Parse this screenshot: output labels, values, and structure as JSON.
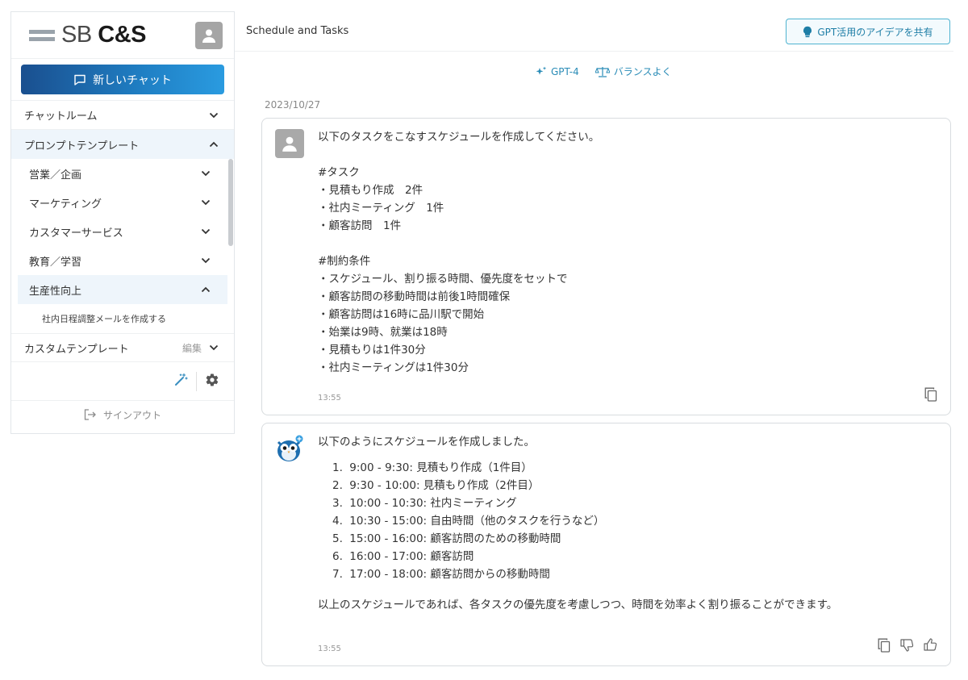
{
  "brand": {
    "logo_prefix": "SB ",
    "logo_main": "C&S"
  },
  "sidebar": {
    "new_chat_label": "新しいチャット",
    "chat_room_label": "チャットルーム",
    "prompt_template_label": "プロンプトテンプレート",
    "categories": [
      {
        "label": "営業／企画"
      },
      {
        "label": "マーケティング"
      },
      {
        "label": "カスタマーサービス"
      },
      {
        "label": "教育／学習"
      },
      {
        "label": "生産性向上"
      }
    ],
    "sub_item_label": "社内日程調整メールを作成する",
    "custom_template_label": "カスタムテンプレート",
    "edit_label": "編集",
    "signout_label": "サインアウト"
  },
  "header": {
    "title": "Schedule and Tasks",
    "share_label": "GPT活用のアイデアを共有"
  },
  "mode": {
    "model_label": "GPT-4",
    "style_label": "バランスよく"
  },
  "conversation": {
    "date": "2023/10/27",
    "user_message": {
      "lines": [
        "以下のタスクをこなすスケジュールを作成してください。",
        "",
        "#タスク",
        "・見積もり作成　2件",
        "・社内ミーティング　1件",
        "・顧客訪問　1件",
        "",
        "#制約条件",
        "・スケジュール、割り振る時間、優先度をセットで",
        "・顧客訪問の移動時間は前後1時間確保",
        "・顧客訪問は16時に品川駅で開始",
        "・始業は9時、就業は18時",
        "・見積もりは1件30分",
        "・社内ミーティングは1件30分"
      ],
      "time": "13:55"
    },
    "bot_message": {
      "intro": "以下のようにスケジュールを作成しました。",
      "items": [
        {
          "num": "1.",
          "text": "9:00 - 9:30: 見積もり作成（1件目）"
        },
        {
          "num": "2.",
          "text": "9:30 - 10:00: 見積もり作成（2件目）"
        },
        {
          "num": "3.",
          "text": "10:00 - 10:30: 社内ミーティング"
        },
        {
          "num": "4.",
          "text": "10:30 - 15:00: 自由時間（他のタスクを行うなど）"
        },
        {
          "num": "5.",
          "text": "15:00 - 16:00: 顧客訪問のための移動時間"
        },
        {
          "num": "6.",
          "text": "16:00 - 17:00: 顧客訪問"
        },
        {
          "num": "7.",
          "text": "17:00 - 18:00: 顧客訪問からの移動時間"
        }
      ],
      "closing": "以上のスケジュールであれば、各タスクの優先度を考慮しつつ、時間を効率よく割り振ることができます。",
      "time": "13:55"
    }
  },
  "colors": {
    "accent": "#1f7fc4",
    "link": "#2a8cb7",
    "active_bg": "#eef5fb"
  }
}
